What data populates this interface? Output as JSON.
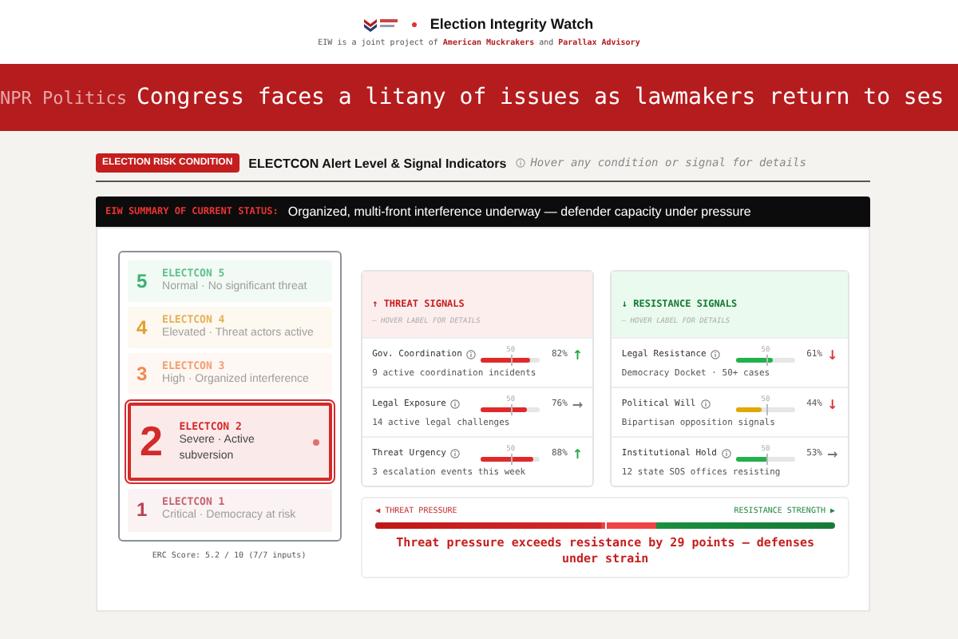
{
  "header": {
    "title": "Election Integrity Watch",
    "byline": [
      {
        "kind": "text",
        "text": "EIW is a joint project of"
      },
      {
        "kind": "link",
        "text": "American Muckrakers"
      },
      {
        "kind": "text",
        "text": "and"
      },
      {
        "kind": "link",
        "text": "Parallax Advisory"
      }
    ]
  },
  "ticker": {
    "source": "NPR Politics",
    "headline": "Congress faces a litany of issues as lawmakers return to ses"
  },
  "section": {
    "badge": "ELECTION RISK CONDITION",
    "title": "ELECTCON Alert Level & Signal Indicators",
    "hint": "Hover any condition or signal for details"
  },
  "summary": {
    "label": "EIW SUMMARY OF CURRENT STATUS:",
    "text": "Organized, multi-front interference underway — defender capacity under pressure"
  },
  "electcon": {
    "levels": [
      {
        "number": "5",
        "name": "ELECTCON 5",
        "description": "Normal · No significant threat",
        "color": "#3cb371",
        "selected": false
      },
      {
        "number": "4",
        "name": "ELECTCON 4",
        "description": "Elevated · Threat actors active",
        "color": "#e0a030",
        "selected": false
      },
      {
        "number": "3",
        "name": "ELECTCON 3",
        "description": "High · Organized interference",
        "color": "#f08a50",
        "selected": false
      },
      {
        "number": "2",
        "name": "ELECTCON 2",
        "description": "Severe · Active subversion",
        "color": "#d42a2a",
        "selected": true
      },
      {
        "number": "1",
        "name": "ELECTCON 1",
        "description": "Critical · Democracy at risk",
        "color": "#b84050",
        "selected": false
      }
    ],
    "score": "ERC Score: 5.2 / 10 (7/7 inputs)"
  },
  "panels": [
    {
      "kind": "threat",
      "title": "↑ THREAT SIGNALS",
      "subtitle": "— HOVER LABEL FOR DETAILS",
      "signals": [
        {
          "name": "Gov. Coordination",
          "marker": "50",
          "level": 0.82,
          "reading": "82%",
          "trend": "↑",
          "color": "#22aa44",
          "detail": "9 active coordination incidents"
        },
        {
          "name": "Legal Exposure",
          "marker": "50",
          "level": 0.76,
          "reading": "76%",
          "trend": "→",
          "color": "#777777",
          "detail": "14 active legal challenges"
        },
        {
          "name": "Threat Urgency",
          "marker": "50",
          "level": 0.88,
          "reading": "88%",
          "trend": "↑",
          "color": "#22aa44",
          "detail": "3 escalation events this week"
        }
      ]
    },
    {
      "kind": "resistance",
      "title": "↓ RESISTANCE SIGNALS",
      "subtitle": "— HOVER LABEL FOR DETAILS",
      "signals": [
        {
          "name": "Legal Resistance",
          "marker": "50",
          "level": 0.61,
          "reading": "61%",
          "trend": "↓",
          "color": "#dd3333",
          "detail": "Democracy Docket · 50+ cases"
        },
        {
          "name": "Political Will",
          "marker": "50",
          "level": 0.44,
          "reading": "44%",
          "trend": "↓",
          "color": "#dd3333",
          "detail": "Bipartisan opposition signals"
        },
        {
          "name": "Institutional Hold",
          "marker": "50",
          "level": 0.53,
          "reading": "53%",
          "trend": "→",
          "color": "#777777",
          "detail": "12 state SOS offices resisting"
        }
      ]
    }
  ],
  "pressure": {
    "left": "◀ THREAT PRESSURE",
    "right": "RESISTANCE STRENGTH ▶",
    "level": 0.61,
    "message": "Threat pressure exceeds resistance by 29 points — defenses under strain"
  }
}
